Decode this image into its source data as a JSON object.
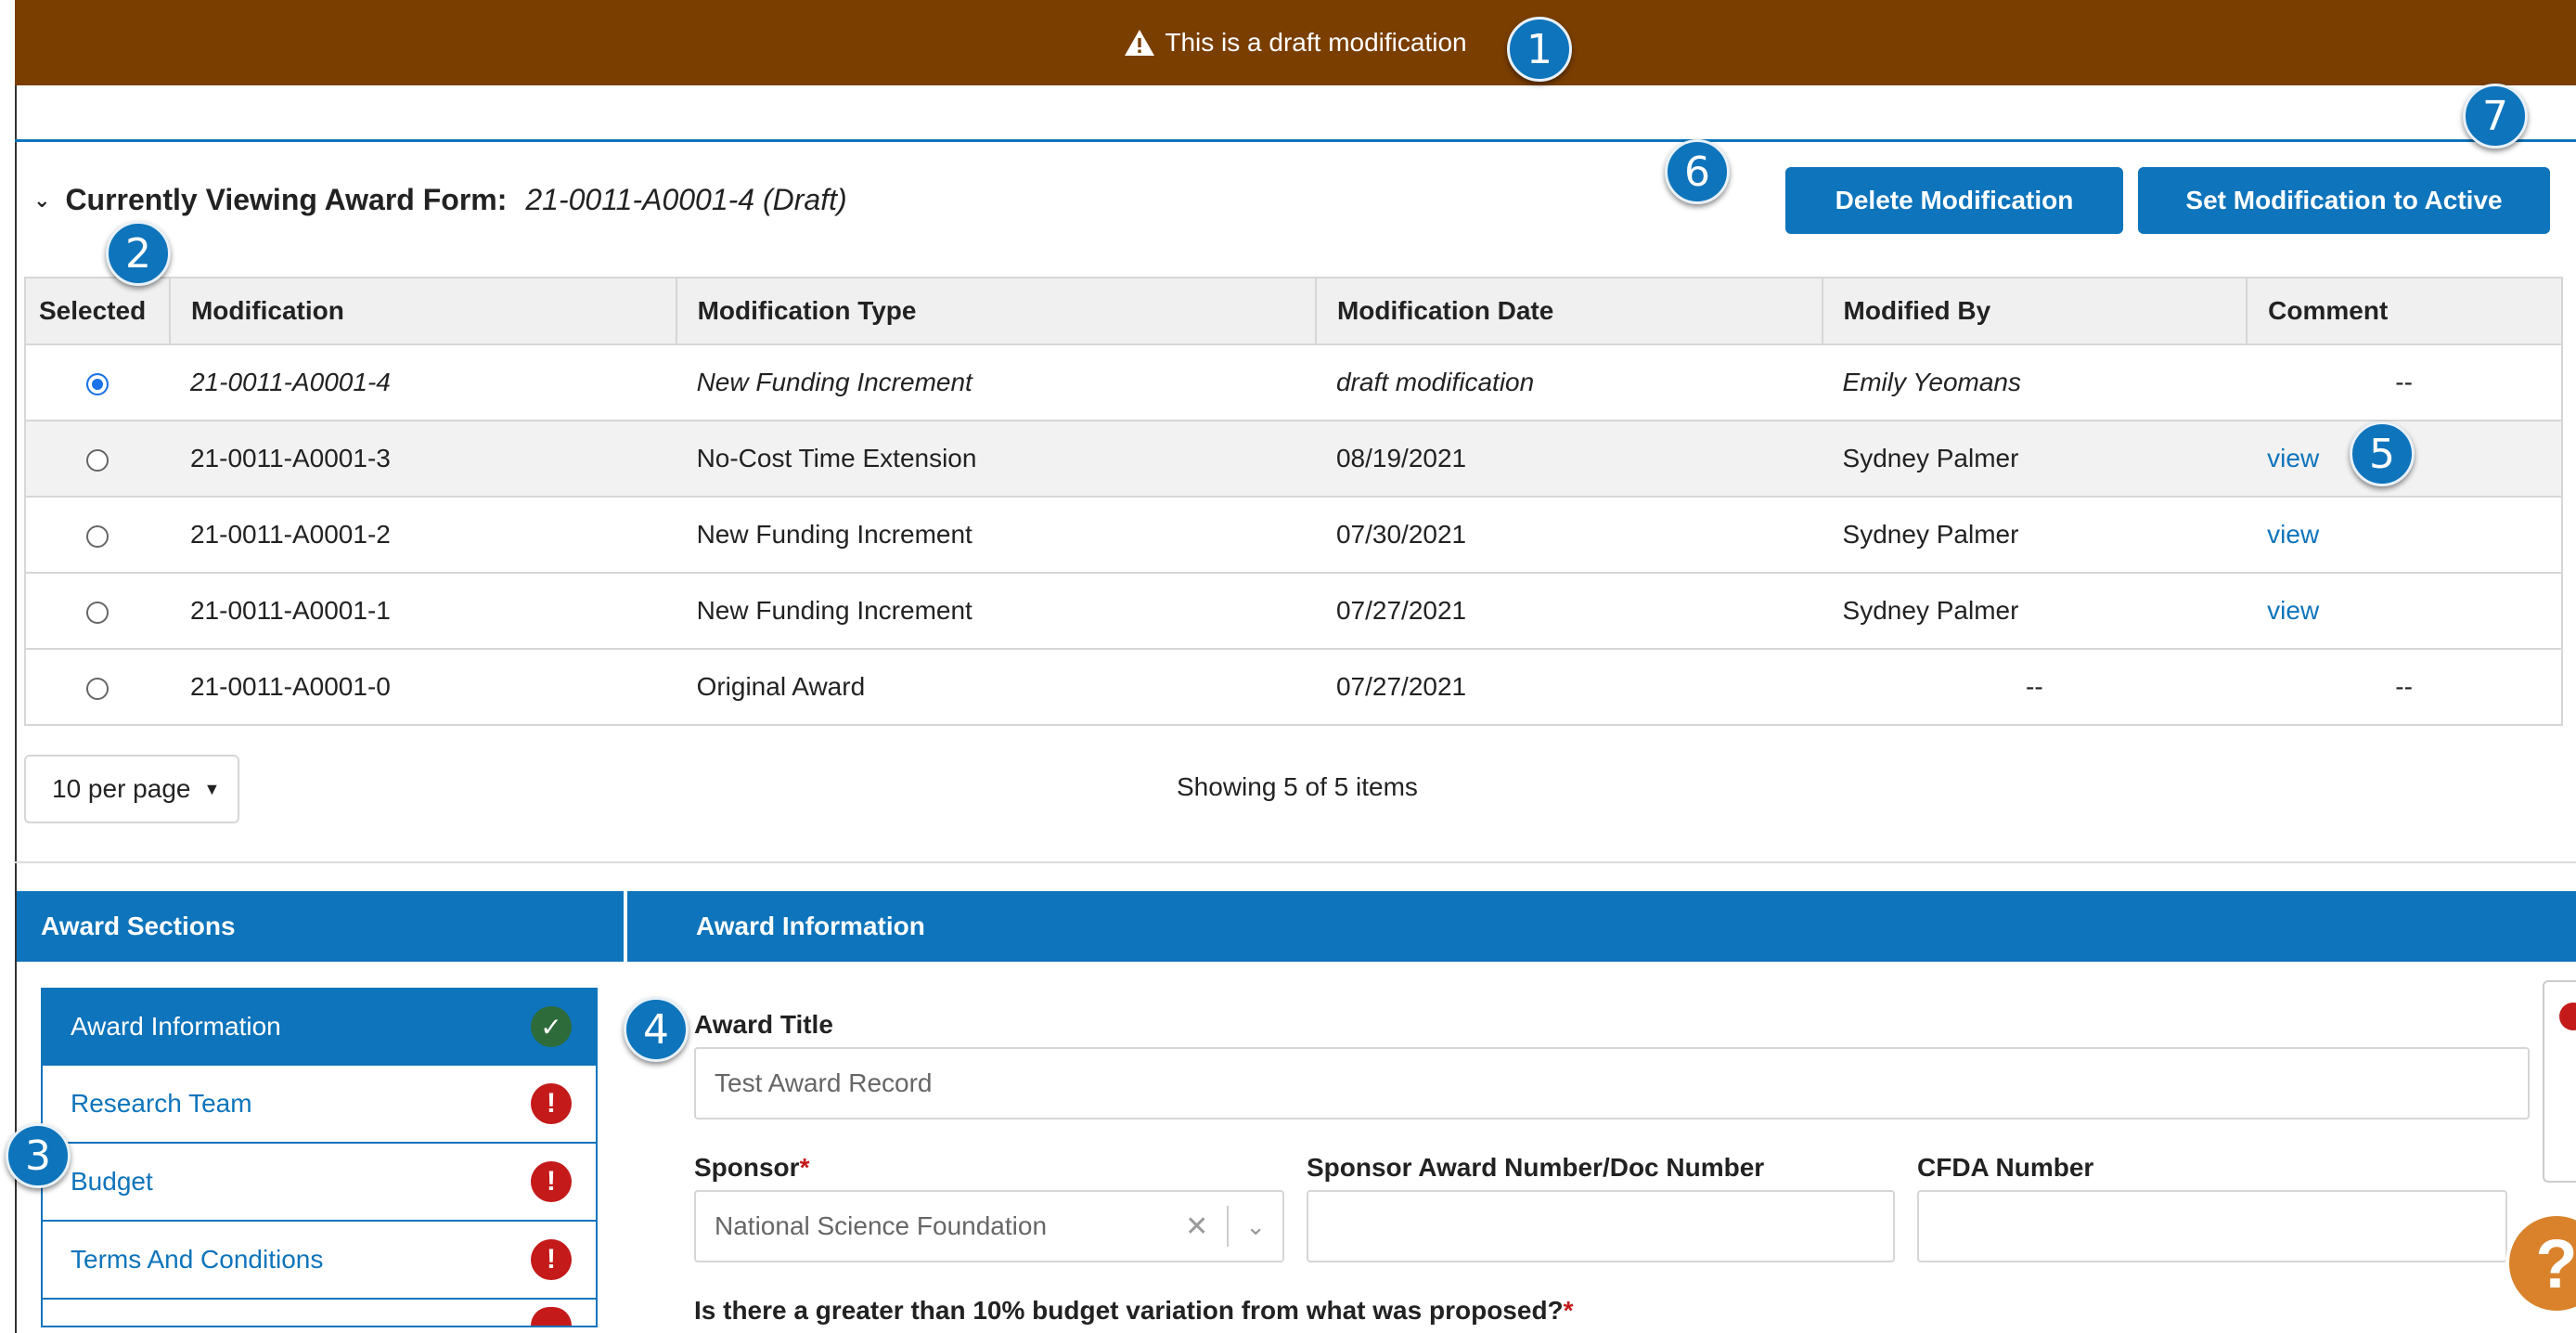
{
  "banner": {
    "text": "This is a draft modification"
  },
  "callouts": [
    "1",
    "2",
    "3",
    "4",
    "5",
    "6",
    "7"
  ],
  "viewing": {
    "label": "Currently Viewing Award Form:",
    "value": "21-0011-A0001-4 (Draft)"
  },
  "actions": {
    "delete_label": "Delete Modification",
    "set_active_label": "Set Modification to Active"
  },
  "table": {
    "headers": [
      "Selected",
      "Modification",
      "Modification Type",
      "Modification Date",
      "Modified By",
      "Comment"
    ],
    "rows": [
      {
        "modification": "21-0011-A0001-4",
        "type": "New Funding Increment",
        "date": "draft modification",
        "by": "Emily Yeomans",
        "comment": "--"
      },
      {
        "modification": "21-0011-A0001-3",
        "type": "No-Cost Time Extension",
        "date": "08/19/2021",
        "by": "Sydney Palmer",
        "comment": "view"
      },
      {
        "modification": "21-0011-A0001-2",
        "type": "New Funding Increment",
        "date": "07/30/2021",
        "by": "Sydney Palmer",
        "comment": "view"
      },
      {
        "modification": "21-0011-A0001-1",
        "type": "New Funding Increment",
        "date": "07/27/2021",
        "by": "Sydney Palmer",
        "comment": "view"
      },
      {
        "modification": "21-0011-A0001-0",
        "type": "Original Award",
        "date": "07/27/2021",
        "by": "--",
        "comment": "--"
      }
    ]
  },
  "pagination": {
    "per_page": "10 per page",
    "showing": "Showing 5 of 5 items"
  },
  "sections": {
    "title": "Award Sections",
    "items": [
      {
        "label": "Award Information",
        "status": "complete"
      },
      {
        "label": "Research Team",
        "status": "error"
      },
      {
        "label": "Budget",
        "status": "error"
      },
      {
        "label": "Terms And Conditions",
        "status": "error"
      }
    ]
  },
  "award_info": {
    "title": "Award Information",
    "award_title_label": "Award Title",
    "award_title_value": "Test Award Record",
    "sponsor_label": "Sponsor",
    "sponsor_value": "National Science Foundation",
    "sponsor_award_label": "Sponsor Award Number/Doc Number",
    "sponsor_award_value": "",
    "cfda_label": "CFDA Number",
    "cfda_value": "",
    "variation_label": "Is there a greater than 10% budget variation from what was proposed?"
  },
  "help": {
    "label": "?"
  },
  "colors": {
    "banner": "#7a3e00",
    "primary": "#0e74bb",
    "error": "#c41a1a",
    "success": "#2e6b3a",
    "help": "#d9822b"
  }
}
